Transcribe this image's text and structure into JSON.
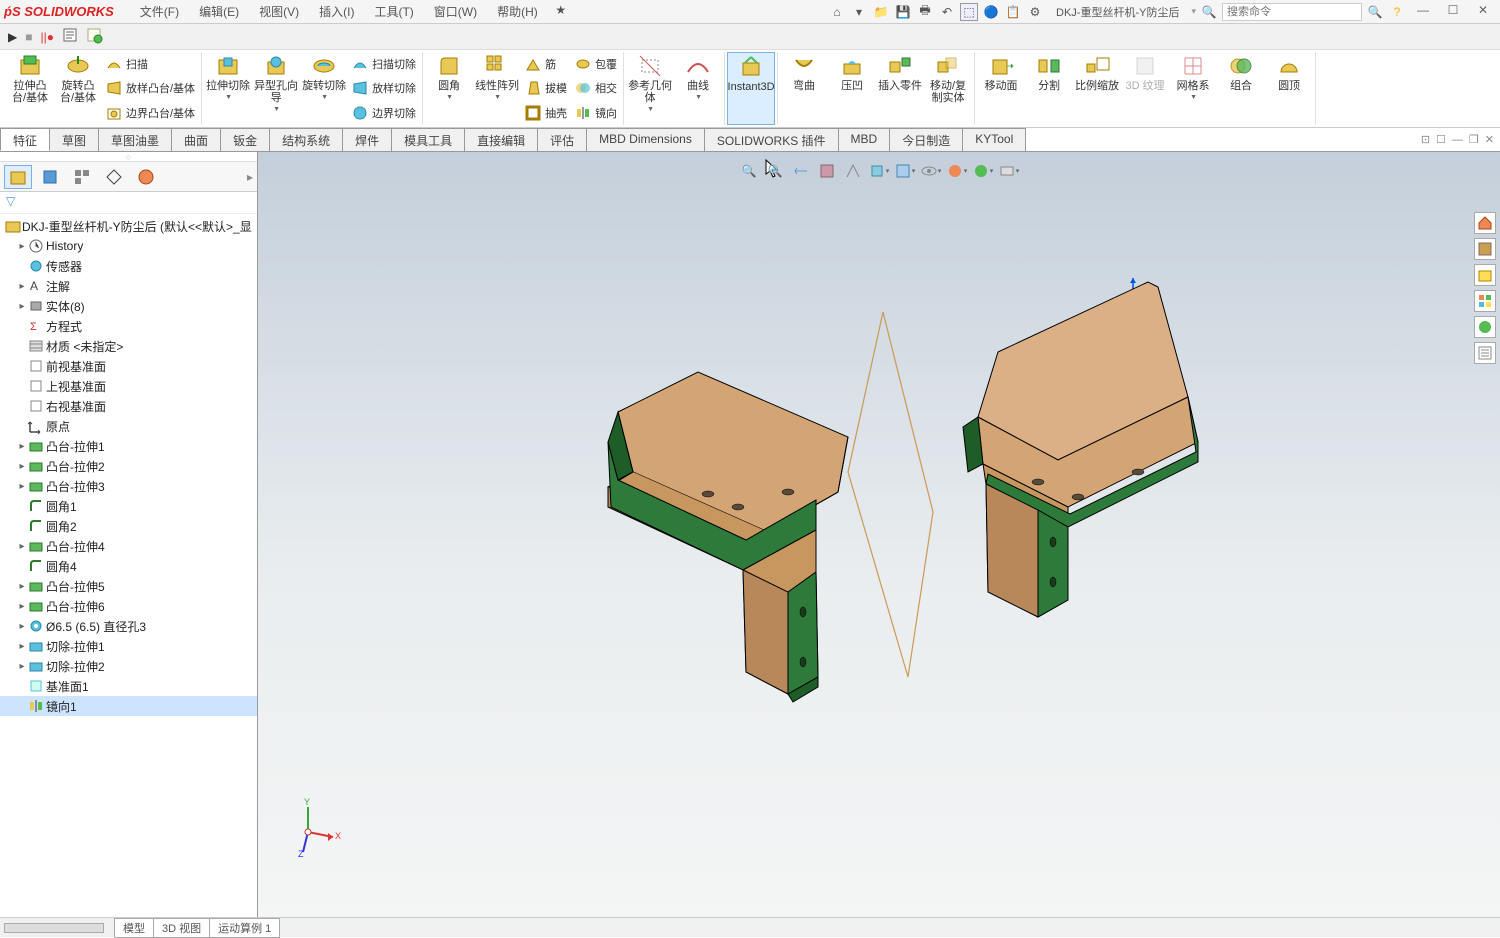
{
  "app": {
    "logo": "SOLIDWORKS",
    "doc_title": "DKJ-重型丝杆机-Y防尘后"
  },
  "menu": {
    "file": "文件(F)",
    "edit": "编辑(E)",
    "view": "视图(V)",
    "insert": "插入(I)",
    "tools": "工具(T)",
    "window": "窗口(W)",
    "help": "帮助(H)"
  },
  "search": {
    "placeholder": "搜索命令"
  },
  "ribbon": {
    "extrude_boss": "拉伸凸台/基体",
    "revolve_boss": "旋转凸台/基体",
    "sweep": "扫描",
    "loft_boss": "放样凸台/基体",
    "boundary_boss": "边界凸台/基体",
    "extruded_cut": "拉伸切除",
    "hole_wizard": "异型孔向导",
    "revolved_cut": "旋转切除",
    "swept_cut": "扫描切除",
    "lofted_cut": "放样切除",
    "boundary_cut": "边界切除",
    "fillet": "圆角",
    "linear_pattern": "线性阵列",
    "rib": "筋",
    "draft": "拔模",
    "shell": "抽壳",
    "wrap": "包覆",
    "intersect": "相交",
    "mirror": "镜向",
    "ref_geom": "参考几何体",
    "curves": "曲线",
    "instant3d": "Instant3D",
    "flex": "弯曲",
    "indent": "压凹",
    "insert_part": "插入零件",
    "move_copy": "移动/复制实体",
    "move_face": "移动面",
    "split": "分割",
    "scale": "比例缩放",
    "texture3d": "3D 纹理",
    "mesh": "网格系",
    "combine": "组合",
    "dome": "圆顶"
  },
  "tabs": {
    "features": "特征",
    "sketch": "草图",
    "sketch_ink": "草图油墨",
    "surfaces": "曲面",
    "sheet_metal": "钣金",
    "structure": "结构系统",
    "weldments": "焊件",
    "mold_tools": "模具工具",
    "direct_edit": "直接编辑",
    "evaluate": "评估",
    "mbd_dim": "MBD Dimensions",
    "sw_addins": "SOLIDWORKS 插件",
    "mbd": "MBD",
    "today_mfg": "今日制造",
    "kytool": "KYTool"
  },
  "tree": {
    "root": "DKJ-重型丝杆机-Y防尘后  (默认<<默认>_显",
    "history": "History",
    "sensors": "传感器",
    "annotations": "注解",
    "solid_bodies": "实体(8)",
    "equations": "方程式",
    "material": "材质 <未指定>",
    "front_plane": "前视基准面",
    "top_plane": "上视基准面",
    "right_plane": "右视基准面",
    "origin": "原点",
    "boss1": "凸台-拉伸1",
    "boss2": "凸台-拉伸2",
    "boss3": "凸台-拉伸3",
    "fillet1": "圆角1",
    "fillet2": "圆角2",
    "boss4": "凸台-拉伸4",
    "fillet4": "圆角4",
    "boss5": "凸台-拉伸5",
    "boss6": "凸台-拉伸6",
    "hole": "Ø6.5 (6.5) 直径孔3",
    "cut1": "切除-拉伸1",
    "cut2": "切除-拉伸2",
    "plane1": "基准面1",
    "mirror1": "镜向1"
  },
  "bottom": {
    "model": "模型",
    "view3d": "3D 视图",
    "motion": "运动算例 1"
  }
}
